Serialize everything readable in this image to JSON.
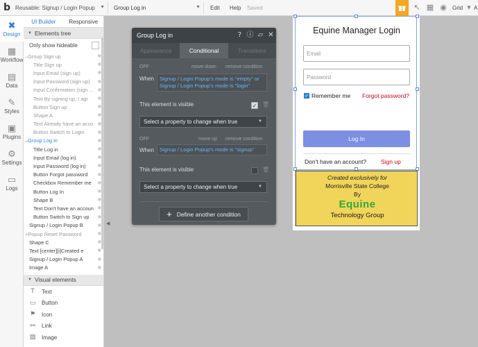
{
  "topbar": {
    "logo": "b",
    "page_select": "Reusable: Signup / Login Popup",
    "element_select": "Group Log in",
    "edit": "Edit",
    "help": "Help",
    "saved": "Saved",
    "grid": "Grid",
    "more": "A"
  },
  "rail": [
    {
      "label": "Design",
      "icon": "design-icon",
      "glyph": "✖",
      "active": true
    },
    {
      "label": "Workflow",
      "icon": "workflow-icon",
      "glyph": "▦",
      "active": false
    },
    {
      "label": "Data",
      "icon": "data-icon",
      "glyph": "▤",
      "active": false
    },
    {
      "label": "Styles",
      "icon": "styles-icon",
      "glyph": "✎",
      "active": false
    },
    {
      "label": "Plugins",
      "icon": "plugins-icon",
      "glyph": "▣",
      "active": false
    },
    {
      "label": "Settings",
      "icon": "settings-icon",
      "glyph": "⚙",
      "active": false
    },
    {
      "label": "Logs",
      "icon": "logs-icon",
      "glyph": "▭",
      "active": false
    }
  ],
  "panel": {
    "tab_ui": "UI Builder",
    "tab_responsive": "Responsive",
    "elements_tree": "Elements tree",
    "only_hideable": "Only show hideable",
    "tree": [
      {
        "label": "Group Sign up",
        "indent": 0,
        "state": "dim",
        "collapse": "–"
      },
      {
        "label": "Title Sign up",
        "indent": 1,
        "state": "dim"
      },
      {
        "label": "Input Email (sign up)",
        "indent": 1,
        "state": "dim"
      },
      {
        "label": "Input Password (sign up)",
        "indent": 1,
        "state": "dim"
      },
      {
        "label": "Input Confirmation (sign ...",
        "indent": 1,
        "state": "dim"
      },
      {
        "label": "Text By signing up, I agr",
        "indent": 1,
        "state": "dim"
      },
      {
        "label": "Button Sign up",
        "indent": 1,
        "state": "dim"
      },
      {
        "label": "Shape A",
        "indent": 1,
        "state": "dim"
      },
      {
        "label": "Text Already have an acco",
        "indent": 1,
        "state": "dim"
      },
      {
        "label": "Button Switch to Login",
        "indent": 1,
        "state": "dim"
      },
      {
        "label": "Group Log in",
        "indent": 0,
        "state": "sel",
        "collapse": "–"
      },
      {
        "label": "Title Log in",
        "indent": 1,
        "state": "vis"
      },
      {
        "label": "Input Email (log in)",
        "indent": 1,
        "state": "vis"
      },
      {
        "label": "Input Password (log in)",
        "indent": 1,
        "state": "vis"
      },
      {
        "label": "Button Forgot password",
        "indent": 1,
        "state": "vis"
      },
      {
        "label": "Checkbox Remember me",
        "indent": 1,
        "state": "vis"
      },
      {
        "label": "Button Log In",
        "indent": 1,
        "state": "vis"
      },
      {
        "label": "Shape B",
        "indent": 1,
        "state": "vis"
      },
      {
        "label": "Text Don't have an accoun",
        "indent": 1,
        "state": "vis"
      },
      {
        "label": "Button Switch to Sign up",
        "indent": 1,
        "state": "vis"
      },
      {
        "label": "Signup / Login Popup B",
        "indent": 0,
        "state": "vis"
      },
      {
        "label": "Popup Reset Password",
        "indent": 0,
        "state": "dim",
        "collapse": "+"
      },
      {
        "label": "Shape C",
        "indent": 0,
        "state": "vis"
      },
      {
        "label": "Text [center][i]Created e",
        "indent": 0,
        "state": "vis"
      },
      {
        "label": "Signup / Login Popup A",
        "indent": 0,
        "state": "vis"
      },
      {
        "label": "Image A",
        "indent": 0,
        "state": "vis"
      }
    ],
    "visual_elements": "Visual elements",
    "visual": [
      {
        "label": "Text",
        "glyph": "T",
        "icon": "text-icon"
      },
      {
        "label": "Button",
        "glyph": "▭",
        "icon": "button-icon"
      },
      {
        "label": "Icon",
        "glyph": "⚑",
        "icon": "flag-icon"
      },
      {
        "label": "Link",
        "glyph": "⚯",
        "icon": "link-icon"
      },
      {
        "label": "Image",
        "glyph": "▨",
        "icon": "image-icon"
      }
    ]
  },
  "conditional": {
    "title": "Group Log in",
    "tabs": [
      "Appearance",
      "Conditional",
      "Transitions"
    ],
    "active_tab": "Conditional",
    "cond1": {
      "off": "OFF",
      "move": "move down",
      "remove": "remove condition",
      "when": "When",
      "expression": "Signup / Login Popup's mode is \"empty\" or Signup / Login Popup's mode is \"login\"",
      "visible_label": "This element is visible",
      "visible_checked": true,
      "select_prop": "Select a property to change when true"
    },
    "cond2": {
      "off": "OFF",
      "move": "move up",
      "remove": "remove condition",
      "when": "When",
      "expression": "Signup / Login Popup's mode is \"signup\"",
      "visible_label": "This element is visible",
      "visible_checked": false,
      "select_prop": "Select a property to change when true"
    },
    "define_btn": "Define another condition"
  },
  "popup": {
    "title": "Equine Manager Login",
    "email_placeholder": "Email",
    "password_placeholder": "Password",
    "remember": "Remember me",
    "forgot": "Forgot password?",
    "login_btn": "Log In",
    "no_account": "Don't have an account?",
    "signup": "Sign up",
    "login_color": "#7c8fe3",
    "link_color": "#d0021b"
  },
  "sponsor": {
    "created": "Created exclusively for",
    "college": "Morrisville State College",
    "by": "By",
    "logo_text": "Equine",
    "tech": "Technology Group",
    "background": "#f1d45a"
  }
}
